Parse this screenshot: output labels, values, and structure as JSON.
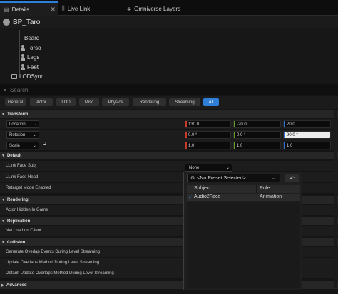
{
  "tabs": [
    {
      "label": "Details",
      "icon": "details-icon",
      "closable": true
    },
    {
      "label": "Live Link",
      "icon": "live-link-icon"
    },
    {
      "label": "Omniverse Layers",
      "icon": "layers-icon"
    }
  ],
  "actor": {
    "name": "BP_Taro",
    "icon": "actor-icon"
  },
  "components": [
    {
      "label": "Beard",
      "icon": "skeletal-mesh-icon"
    },
    {
      "label": "Torso",
      "icon": "skeletal-mesh-icon"
    },
    {
      "label": "Legs",
      "icon": "skeletal-mesh-icon"
    },
    {
      "label": "Feet",
      "icon": "skeletal-mesh-icon"
    },
    {
      "label": "LODSync",
      "icon": "component-icon"
    }
  ],
  "search": {
    "placeholder": "Search",
    "value": ""
  },
  "filters": [
    "General",
    "Actor",
    "LOD",
    "Misc",
    "Physics",
    "Rendering",
    "Streaming",
    "All"
  ],
  "active_filter": "All",
  "transform": {
    "title": "Transform",
    "rows": [
      {
        "mode": "Location",
        "x": "130.0",
        "y": "-20.0",
        "z": "20.0"
      },
      {
        "mode": "Rotation",
        "x": "0.0 °",
        "y": "0.0 °",
        "z": "90.0 °"
      },
      {
        "mode": "Scale",
        "x": "1.0",
        "y": "1.0",
        "z": "1.0"
      }
    ]
  },
  "default": {
    "title": "Default",
    "llink_face_subj": {
      "label": "LLink Face Subj",
      "value": "None"
    },
    "llink_face_head": {
      "label": "LLink Face Head"
    },
    "retarget_mode": {
      "label": "Retarget Mode Enabled"
    }
  },
  "preset_popup": {
    "preset": "<No Preset Selected>",
    "columns": [
      "Subject",
      "Role"
    ],
    "rows": [
      {
        "subject": "Audio2Face",
        "role": "Animation"
      }
    ]
  },
  "rendering": {
    "title": "Rendering",
    "row": "Actor Hidden In Game"
  },
  "replication": {
    "title": "Replication",
    "row": "Net Load on Client"
  },
  "collision": {
    "title": "Collision",
    "rows": [
      "Generate Overlap Events During Level Streaming",
      "Update Overlaps Method During Level Streaming",
      "Default Update Overlaps Method During Level Streaming"
    ]
  },
  "advanced": {
    "title": "Advanced"
  },
  "colors": {
    "accent": "#2f7fd8",
    "x_axis": "#c83a2c",
    "y_axis": "#6a9f2d",
    "z_axis": "#2f6fd0"
  }
}
